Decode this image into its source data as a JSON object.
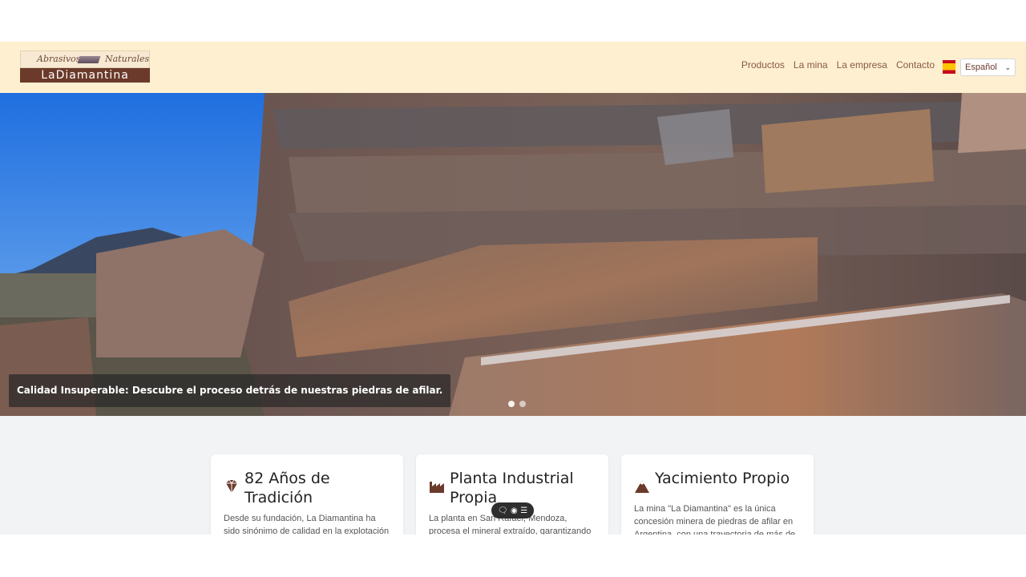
{
  "header": {
    "logo": {
      "script_left": "Abrasivos",
      "script_right": "Naturales",
      "name": "LaDiamantina"
    },
    "nav": [
      "Productos",
      "La mina",
      "La empresa",
      "Contacto"
    ],
    "language": {
      "selected": "Español",
      "flag": "spain-flag-icon"
    }
  },
  "hero": {
    "caption": "Calidad Insuperable: Descubre el proceso detrás de nuestras piedras de afilar.",
    "slides": 2,
    "active_slide": 1
  },
  "cards": [
    {
      "icon": "gem-icon",
      "title": "82 Años de Tradición",
      "text": "Desde su fundación, La Diamantina ha sido sinónimo de calidad en la explotación"
    },
    {
      "icon": "factory-icon",
      "title": "Planta Industrial Propia",
      "text": "La planta en San Rafael, Mendoza, procesa el mineral extraído, garantizando la mejor"
    },
    {
      "icon": "mountain-icon",
      "title": "Yacimiento Propio",
      "text": "La mina \"La Diamantina\" es la única concesión minera de piedras de afilar en Argentina, con una trayectoria de más de seis décadas."
    }
  ],
  "colors": {
    "header_bg": "#fdefcf",
    "brand_brown": "#6b3a2a",
    "nav_text": "#8a5a44",
    "page_bg": "#f2f3f5"
  }
}
